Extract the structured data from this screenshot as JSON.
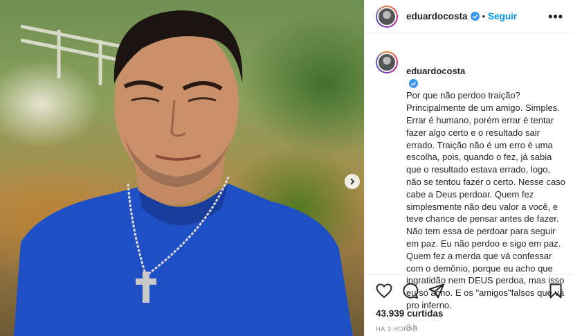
{
  "post": {
    "username": "eduardocosta",
    "follow_label": "Seguir",
    "more_label": "•••",
    "caption": "Por que não perdoo traição? Principalmente de um amigo. Simples. Errar é humano, porém errar é tentar fazer algo certo e o resultado sair errado. Traição não é um erro é uma escolha, pois, quando o fez, já sabia que o resultado estava errado, logo, não se tentou fazer o certo. Nesse caso cabe a Deus perdoar. Quem fez simplesmente não deu valor a você, e teve chance de pensar antes de fazer. Não tem essa de perdoar para seguir em paz. Eu não perdoo e sigo em paz. Quem fez a merda que vá confessar com o demônio, porque eu acho que ingratidão nem DEUS perdoa, mas isso eu só acho. E os \"amigos\"falsos que vá pro inferno.",
    "caption_time": "3 h",
    "likes_label": "43.939 curtidas",
    "posted_label": "HÁ 3 HORAS"
  },
  "colors": {
    "accent": "#0095f6",
    "verified": "#3897f0",
    "text": "#262626",
    "muted": "#8e8e8e",
    "shirt": "#1f4fc4"
  },
  "icons": {
    "verified": "verified-badge-icon",
    "like": "heart-icon",
    "comment": "comment-icon",
    "share": "paper-plane-icon",
    "save": "bookmark-icon",
    "next": "chevron-right-icon"
  }
}
